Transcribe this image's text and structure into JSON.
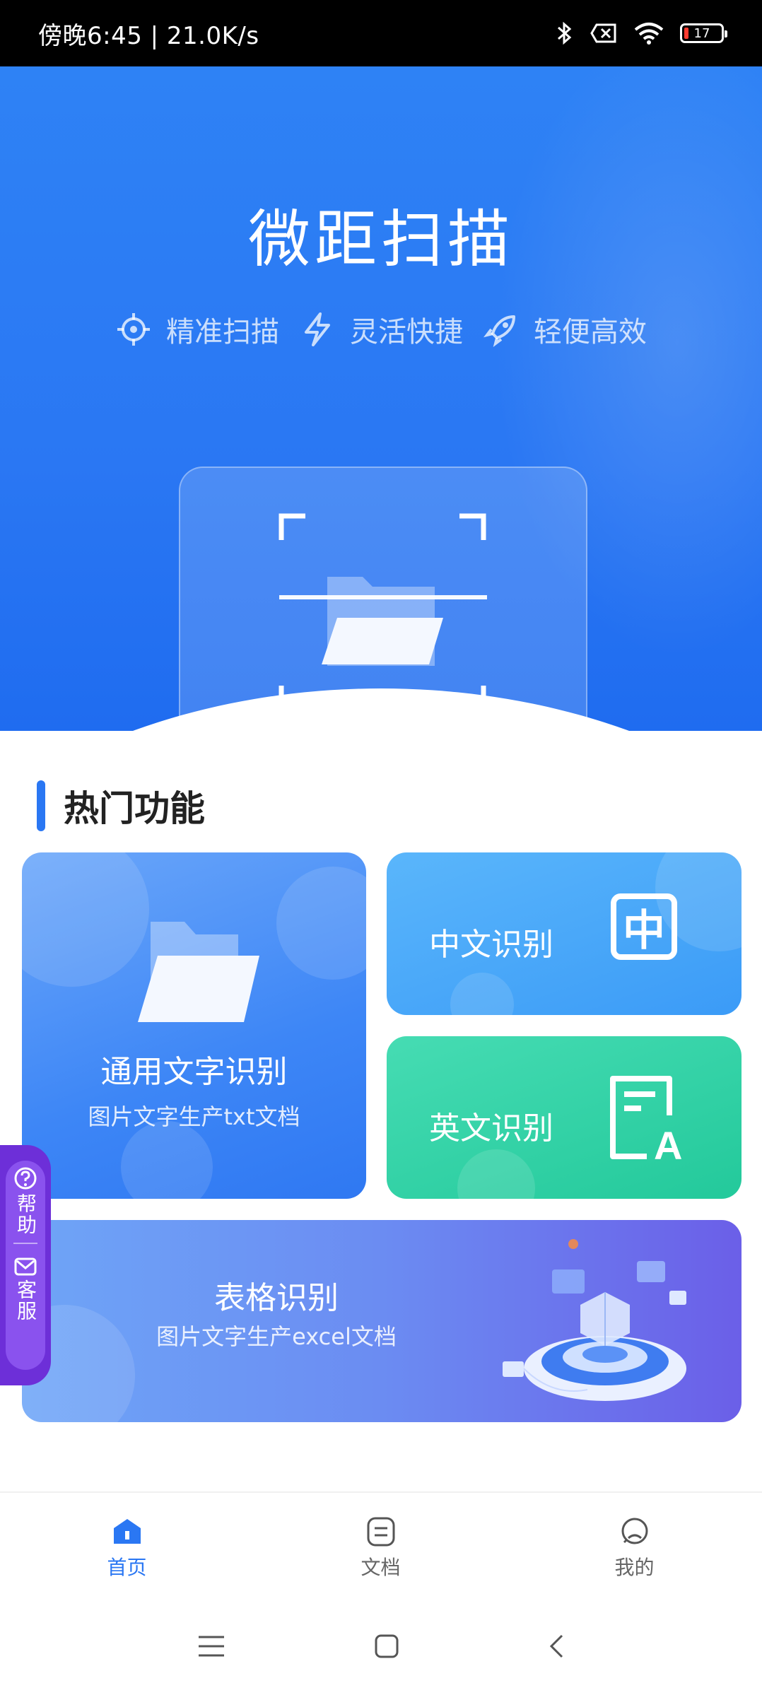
{
  "status_bar": {
    "time_speed": "傍晚6:45 | 21.0K/s",
    "battery": "17"
  },
  "hero": {
    "title": "微距扫描",
    "features": [
      "精准扫描",
      "灵活快捷",
      "轻便高效"
    ]
  },
  "section": {
    "title": "热门功能"
  },
  "cards": {
    "ocr": {
      "title": "通用文字识别",
      "subtitle": "图片文字生产txt文档"
    },
    "chinese": {
      "label": "中文识别",
      "glyph": "中"
    },
    "english": {
      "label": "英文识别"
    },
    "table": {
      "title": "表格识别",
      "subtitle": "图片文字生产excel文档"
    }
  },
  "side_help": {
    "help": "帮助",
    "service": "客服"
  },
  "bottom_nav": {
    "items": [
      "首页",
      "文档",
      "我的"
    ],
    "active": "首页"
  },
  "colors": {
    "accent": "#2a77f3",
    "green": "#23c99b",
    "purple": "#6d2fd8"
  }
}
